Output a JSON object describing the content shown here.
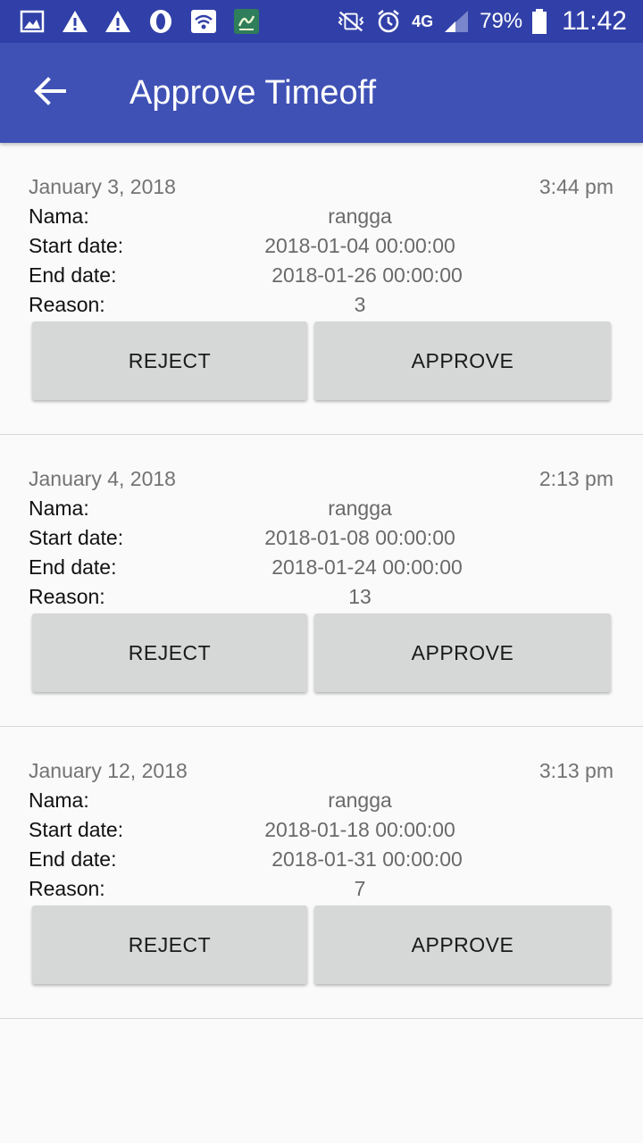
{
  "status_bar": {
    "icons": [
      "gallery-icon",
      "warning-icon",
      "warning-icon",
      "opera-icon",
      "wifi-icon",
      "app-icon"
    ],
    "right_icons": [
      "vibrate-icon",
      "alarm-icon"
    ],
    "network": "4G",
    "battery": "79%",
    "time": "11:42"
  },
  "app_bar": {
    "title": "Approve Timeoff"
  },
  "requests": [
    {
      "date": "January 3, 2018",
      "time": "3:44 pm",
      "name_label": "Nama:",
      "name": "rangga",
      "start_label": "Start date:",
      "start": "2018-01-04 00:00:00",
      "end_label": "End date:",
      "end": "2018-01-26 00:00:00",
      "reason_label": "Reason:",
      "reason": "3",
      "reject_label": "REJECT",
      "approve_label": "APPROVE"
    },
    {
      "date": "January 4, 2018",
      "time": "2:13 pm",
      "name_label": "Nama:",
      "name": "rangga",
      "start_label": "Start date:",
      "start": "2018-01-08 00:00:00",
      "end_label": "End date:",
      "end": "2018-01-24 00:00:00",
      "reason_label": "Reason:",
      "reason": "13",
      "reject_label": "REJECT",
      "approve_label": "APPROVE"
    },
    {
      "date": "January 12, 2018",
      "time": "3:13 pm",
      "name_label": "Nama:",
      "name": "rangga",
      "start_label": "Start date:",
      "start": "2018-01-18 00:00:00",
      "end_label": "End date:",
      "end": "2018-01-31 00:00:00",
      "reason_label": "Reason:",
      "reason": "7",
      "reject_label": "REJECT",
      "approve_label": "APPROVE"
    }
  ]
}
